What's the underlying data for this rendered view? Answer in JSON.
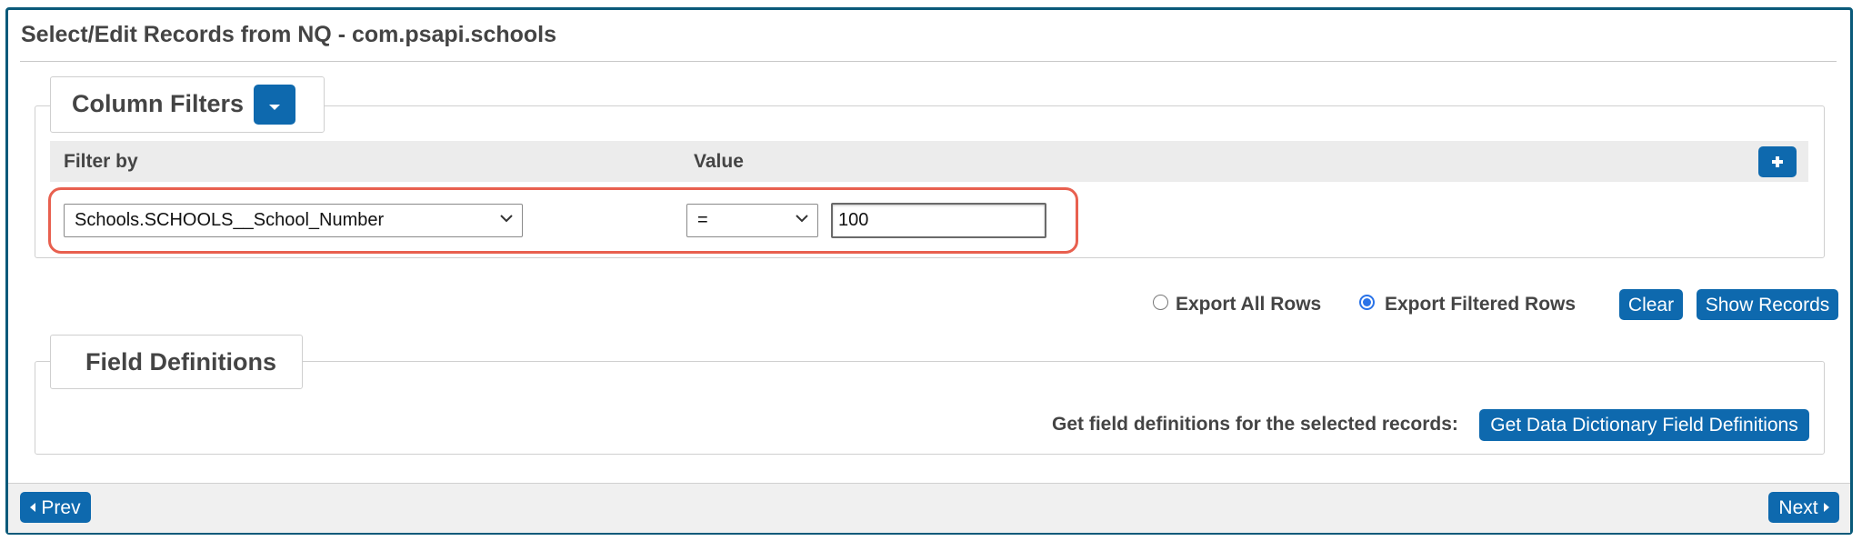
{
  "page": {
    "title": "Select/Edit Records from NQ - com.psapi.schools"
  },
  "column_filters": {
    "legend": "Column Filters",
    "headers": {
      "filter_by": "Filter by",
      "value": "Value"
    },
    "row": {
      "field": "Schools.SCHOOLS__School_Number",
      "operator": "=",
      "value": "100"
    }
  },
  "export": {
    "options": [
      {
        "label": "Export All Rows",
        "checked": false
      },
      {
        "label": "Export Filtered Rows",
        "checked": true
      }
    ],
    "clear_label": "Clear",
    "show_records_label": "Show Records"
  },
  "field_definitions": {
    "legend": "Field Definitions",
    "prompt": "Get field definitions for the selected records:",
    "button_label": "Get Data Dictionary Field Definitions"
  },
  "footer": {
    "prev_label": "Prev",
    "next_label": "Next"
  },
  "colors": {
    "accent": "#0e69ae",
    "highlight": "#e8604f",
    "frame": "#0a5a7a"
  },
  "icons": {
    "dropdown_toggle": "caret-down-icon",
    "add_filter": "plus-icon",
    "select_chevron": "chevron-down-icon",
    "prev": "caret-left-icon",
    "next": "caret-right-icon"
  }
}
